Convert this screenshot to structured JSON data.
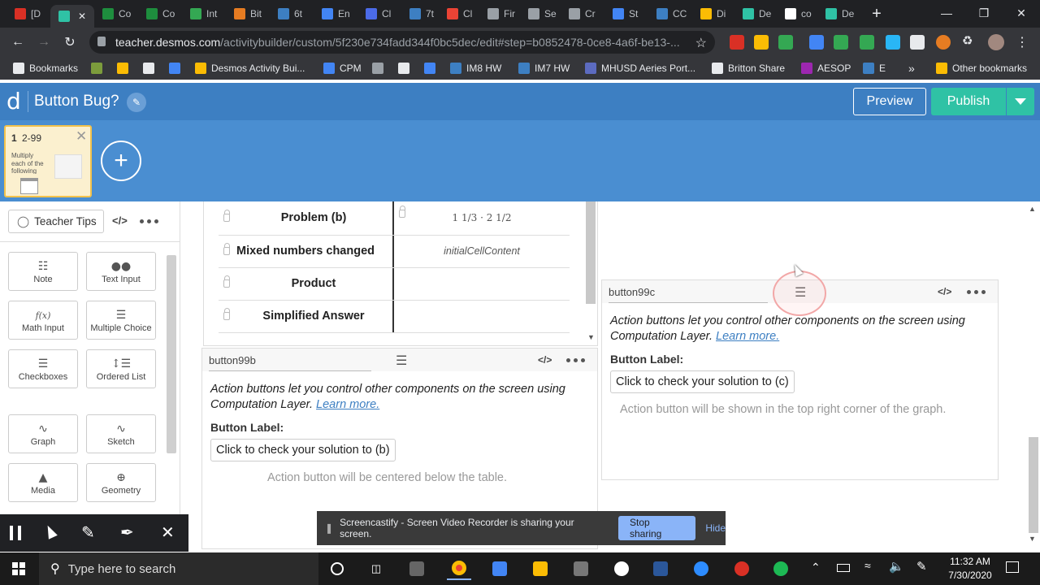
{
  "browser": {
    "tabs": [
      {
        "label": "[D",
        "color": "#d93025"
      },
      {
        "label": "",
        "color": "#2fc2a5",
        "active": true
      },
      {
        "label": "Co",
        "color": "#1e8e3e"
      },
      {
        "label": "Co",
        "color": "#1e8e3e"
      },
      {
        "label": "Int",
        "color": "#34a853"
      },
      {
        "label": "Bit",
        "color": "#e67c22"
      },
      {
        "label": "6t",
        "color": "#3d7fc2"
      },
      {
        "label": "En",
        "color": "#4285f4"
      },
      {
        "label": "Cl",
        "color": "#4b6be8"
      },
      {
        "label": "7t",
        "color": "#3d7fc2"
      },
      {
        "label": "Cl",
        "color": "#ea4335"
      },
      {
        "label": "Fir",
        "color": "#9aa0a6"
      },
      {
        "label": "Se",
        "color": "#9aa0a6"
      },
      {
        "label": "Cr",
        "color": "#9aa0a6"
      },
      {
        "label": "St",
        "color": "#4285f4"
      },
      {
        "label": "CC",
        "color": "#3d7fc2"
      },
      {
        "label": "Di",
        "color": "#fbbc04"
      },
      {
        "label": "De",
        "color": "#2fc2a5"
      },
      {
        "label": "co",
        "color": "#ffffff"
      },
      {
        "label": "De",
        "color": "#2fc2a5"
      }
    ],
    "url_host": "teacher.desmos.com",
    "url_path": "/activitybuilder/custom/5f230e734fadd344f0bc5dec/edit#step=b0852478-0ce8-4a6f-be13-...",
    "bookmarks": [
      {
        "label": "Bookmarks",
        "color": "#e8eaed"
      },
      {
        "label": "",
        "color": "#7c9c3c"
      },
      {
        "label": "",
        "color": "#fbbc04"
      },
      {
        "label": "",
        "color": "#e8eaed"
      },
      {
        "label": "",
        "color": "#4285f4"
      },
      {
        "label": "Desmos Activity Bui...",
        "color": "#fbbc04"
      },
      {
        "label": "CPM",
        "color": "#4285f4"
      },
      {
        "label": "",
        "color": "#9aa0a6"
      },
      {
        "label": "",
        "color": "#e8eaed"
      },
      {
        "label": "",
        "color": "#4285f4"
      },
      {
        "label": "IM8 HW",
        "color": "#3d7fc2"
      },
      {
        "label": "IM7 HW",
        "color": "#3d7fc2"
      },
      {
        "label": "MHUSD Aeries Port...",
        "color": "#5c6bc0"
      },
      {
        "label": "Britton Share",
        "color": "#e8eaed"
      },
      {
        "label": "AESOP",
        "color": "#9c27b0"
      },
      {
        "label": "E",
        "color": "#3d7fc2"
      }
    ],
    "other_bookmarks": "Other bookmarks",
    "overflow": "»"
  },
  "desmos": {
    "logo": "d",
    "title": "Button Bug?",
    "preview_label": "Preview",
    "publish_label": "Publish",
    "slide": {
      "number": "1",
      "range": "2-99",
      "snippet": "Multiply each of the following"
    },
    "add_label": "+"
  },
  "left_panel": {
    "teacher_tips": "Teacher Tips",
    "code_icon": "</>",
    "tools": [
      {
        "label": "Note",
        "icon": "note-icon"
      },
      {
        "label": "Text Input",
        "icon": "text-input-icon"
      },
      {
        "label": "Math Input",
        "icon": "math-input-icon",
        "glyph": "f(x)"
      },
      {
        "label": "Multiple Choice",
        "icon": "multiple-choice-icon"
      },
      {
        "label": "Checkboxes",
        "icon": "checkboxes-icon"
      },
      {
        "label": "Ordered List",
        "icon": "ordered-list-icon"
      },
      {
        "label": "Graph",
        "icon": "graph-icon"
      },
      {
        "label": "Sketch",
        "icon": "sketch-icon"
      },
      {
        "label": "Media",
        "icon": "media-icon"
      },
      {
        "label": "Geometry",
        "icon": "geometry-icon"
      }
    ]
  },
  "table": {
    "rows": [
      {
        "label": "Problem (b)",
        "value": "1 1/3 · 2 1/2"
      },
      {
        "label": "Mixed numbers changed",
        "value": "initialCellContent"
      },
      {
        "label": "Product",
        "value": ""
      },
      {
        "label": "Simplified Answer",
        "value": ""
      }
    ]
  },
  "component_b": {
    "name": "button99b",
    "desc": "Action buttons let you control other components on the screen using Computation Layer.",
    "learn_more": "Learn more.",
    "button_label_heading": "Button Label:",
    "button_label_value": "Click to check your solution to (b)",
    "note": "Action button will be centered below the table."
  },
  "component_c": {
    "name": "button99c",
    "desc": "Action buttons let you control other components on the screen using Computation Layer.",
    "learn_more": "Learn more.",
    "button_label_heading": "Button Label:",
    "button_label_value": "Click to check your solution to (c)",
    "note": "Action button will be shown in the top right corner of the graph."
  },
  "screencastify": {
    "message": "Screencastify - Screen Video Recorder is sharing your screen.",
    "stop_label": "Stop sharing",
    "hide_label": "Hide"
  },
  "taskbar": {
    "search_placeholder": "Type here to search",
    "time": "11:32 AM",
    "date": "7/30/2020"
  }
}
